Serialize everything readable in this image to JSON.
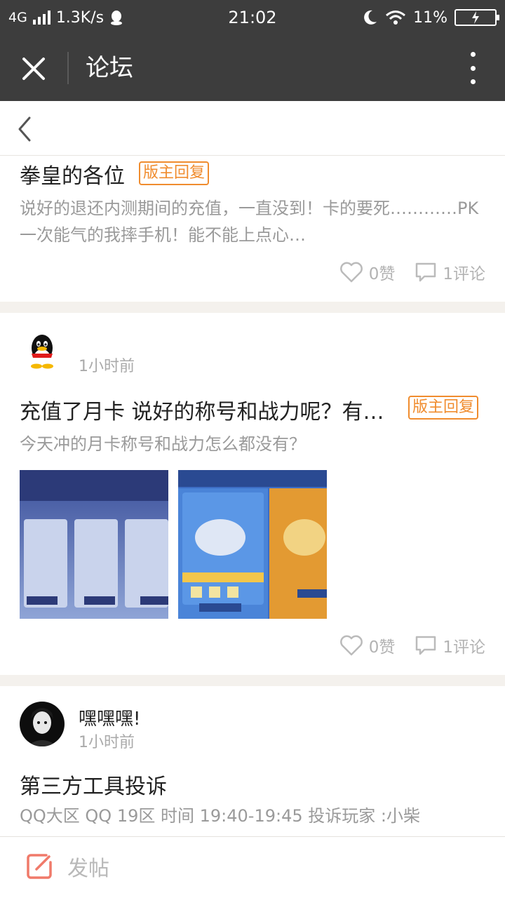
{
  "status_bar": {
    "network": "4G",
    "speed": "1.3K/s",
    "time": "21:02",
    "battery": "11%",
    "icons": [
      "signal-icon",
      "qq-icon",
      "moon-icon",
      "wifi-icon",
      "battery-icon"
    ]
  },
  "app_bar": {
    "title": "论坛",
    "close_icon": "close-icon",
    "more_icon": "more-vertical-icon"
  },
  "back_bar": {
    "back_icon": "chevron-left-icon"
  },
  "posts": [
    {
      "title": "拳皇的各位",
      "badge": "版主回复",
      "body": "说好的退还内测期间的充值，一直没到！卡的要死…………PK一次能气的我摔手机！能不能上点心…",
      "likes": "0赞",
      "comments": "1评论"
    },
    {
      "author": "",
      "time": "1小时前",
      "title": "充值了月卡 说好的称号和战力呢？有…",
      "badge": "版主回复",
      "body": "今天冲的月卡称号和战力怎么都没有？",
      "images": [
        "screenshot-thumbnail-1",
        "screenshot-thumbnail-2"
      ],
      "likes": "0赞",
      "comments": "1评论"
    },
    {
      "author": "嘿嘿嘿!",
      "time": "1小时前",
      "title": "第三方工具投诉",
      "body": "QQ大区 QQ 19区 时间 19:40-19:45 投诉玩家 :小柴"
    }
  ],
  "bottom_bar": {
    "compose_label": "发帖",
    "compose_icon": "edit-icon"
  },
  "colors": {
    "bar": "#3d3d3d",
    "accent": "#f08c2e",
    "compose": "#f07a6a"
  }
}
